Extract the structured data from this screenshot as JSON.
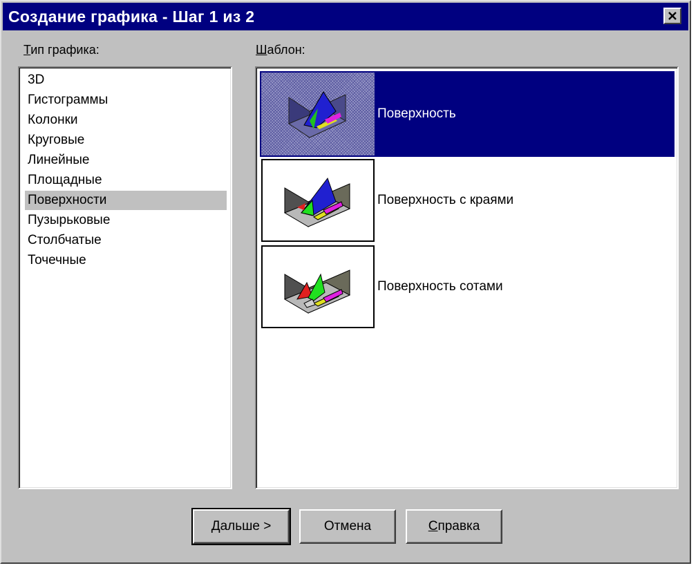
{
  "window": {
    "title": "Создание графика - Шаг 1 из 2"
  },
  "type_panel": {
    "label_mnemonic": "Т",
    "label_rest": "ип графика:",
    "items": [
      {
        "label": "3D"
      },
      {
        "label": "Гистограммы"
      },
      {
        "label": "Колонки"
      },
      {
        "label": "Круговые"
      },
      {
        "label": "Линейные"
      },
      {
        "label": "Площадные"
      },
      {
        "label": "Поверхности",
        "selected": true
      },
      {
        "label": "Пузырьковые"
      },
      {
        "label": "Столбчатые"
      },
      {
        "label": "Точечные"
      }
    ]
  },
  "template_panel": {
    "label_mnemonic": "Ш",
    "label_rest": "аблон:",
    "items": [
      {
        "label": "Поверхность",
        "selected": true,
        "icon": "surface-chart-icon"
      },
      {
        "label": "Поверхность с краями",
        "icon": "surface-edges-chart-icon"
      },
      {
        "label": "Поверхность сотами",
        "icon": "surface-honeycomb-chart-icon"
      }
    ]
  },
  "buttons": {
    "next_mnemonic": "Д",
    "next_rest": "альше >",
    "cancel": "Отмена",
    "help_mnemonic": "С",
    "help_rest": "правка"
  },
  "colors": {
    "title_bar": "#000080",
    "selection": "#000080",
    "face": "#c0c0c0"
  }
}
